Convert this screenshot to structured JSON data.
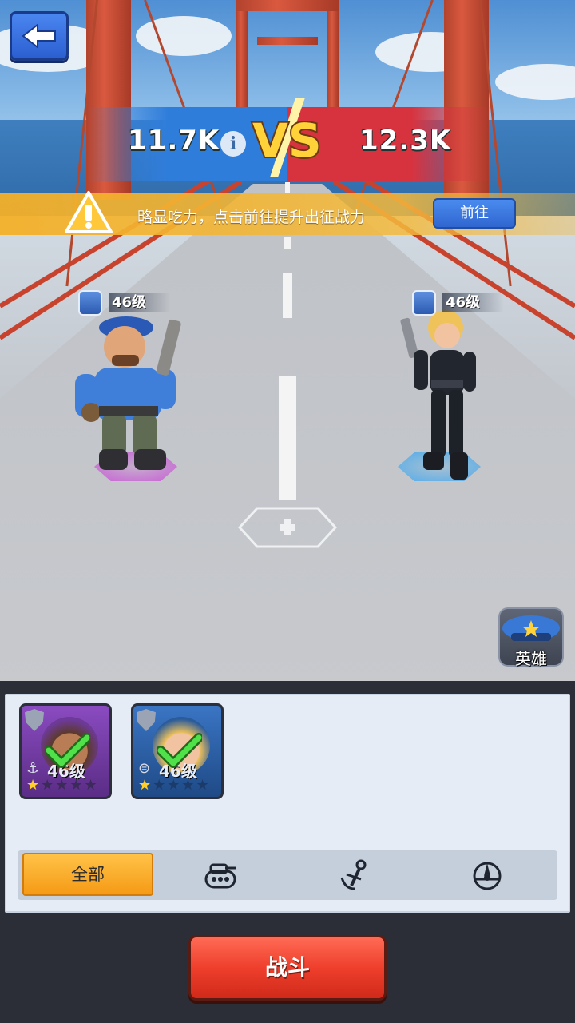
{
  "header": {
    "player_power": "11.7K",
    "enemy_power": "12.3K",
    "vs_label": "VS"
  },
  "warning": {
    "message": "略显吃力，点击前往提升出征战力",
    "goto_label": "前往"
  },
  "player_hero": {
    "level": "46级",
    "ring_color": "#c94fd6"
  },
  "enemy_hero": {
    "level": "46级",
    "ring_color": "#3fa8f0"
  },
  "hero_button": {
    "label": "英雄"
  },
  "roster": {
    "cards": [
      {
        "level": "46级",
        "frame_color": "#6d3a98",
        "stars_filled": 1,
        "stars_total": 5,
        "selected": true
      },
      {
        "level": "46级",
        "frame_color": "#2a5b9a",
        "stars_filled": 1,
        "stars_total": 5,
        "selected": true
      }
    ]
  },
  "filters": {
    "all_label": "全部",
    "icons": [
      "tank-icon",
      "anchor-icon",
      "aircraft-icon"
    ]
  },
  "battle_button": {
    "label": "战斗"
  },
  "colors": {
    "blue_side": "#2f7ddb",
    "red_side": "#d7333f",
    "warning": "#f4b028",
    "accent_orange": "#f59a16",
    "battle_red": "#ee3f2c"
  }
}
